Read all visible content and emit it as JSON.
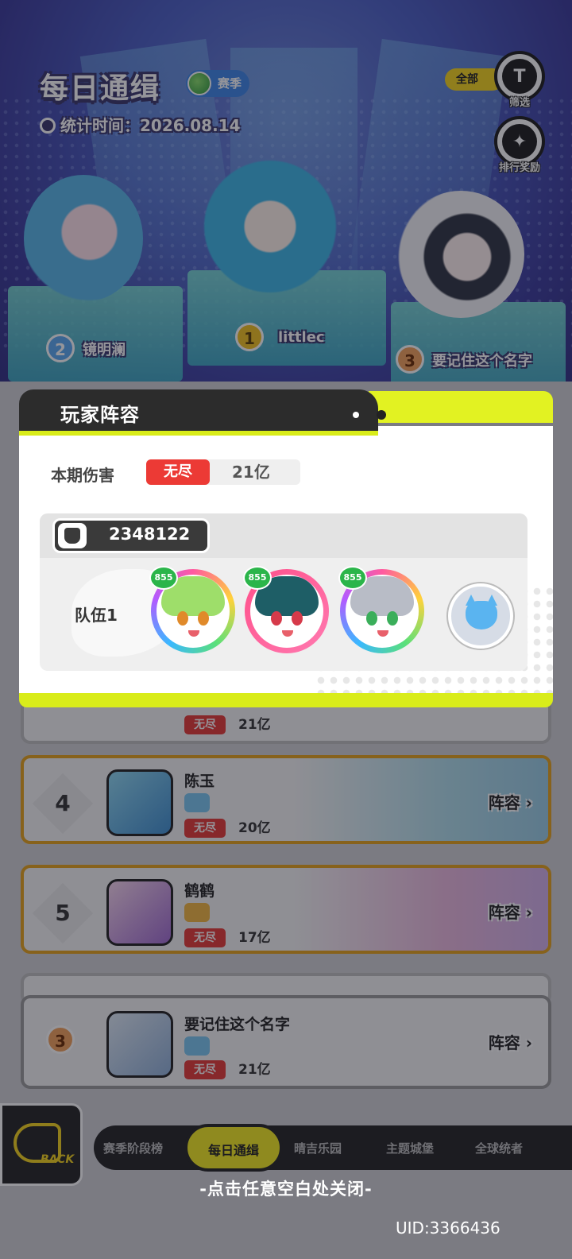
{
  "header": {
    "title": "每日通缉",
    "season": "赛季",
    "stat_time": "统计时间：2026.08.14",
    "filter_all": "全部",
    "filter_label": "筛选",
    "reward_label": "排行奖励"
  },
  "podium": [
    {
      "rank": "1",
      "name": "littlec"
    },
    {
      "rank": "2",
      "name": "镜明澜"
    },
    {
      "rank": "3",
      "name": "要记住这个名字"
    }
  ],
  "modal": {
    "title": "玩家阵容",
    "damage_label": "本期伤害",
    "damage_mode": "无尽",
    "damage_value": "21亿",
    "power": "2348122",
    "team_label": "队伍1",
    "heroes": [
      {
        "level": "855"
      },
      {
        "level": "855"
      },
      {
        "level": "855"
      }
    ]
  },
  "list": {
    "partial_row": {
      "mode": "无尽",
      "damage": "21亿"
    },
    "rows": [
      {
        "rank": "4",
        "name": "陈玉",
        "tag": "",
        "mode": "无尽",
        "damage": "20亿",
        "lineup": "阵容"
      },
      {
        "rank": "5",
        "name": "鹤鹤",
        "tag": "",
        "mode": "无尽",
        "damage": "17亿",
        "lineup": "阵容"
      }
    ],
    "self_row": {
      "rank": "3",
      "name": "要记住这个名字",
      "mode": "无尽",
      "damage": "21亿",
      "lineup": "阵容"
    }
  },
  "tabs": [
    "赛季阶段榜",
    "每日通缉",
    "晴吉乐园",
    "主题城堡",
    "全球统者"
  ],
  "active_tab": "每日通缉",
  "back_label": "BACK",
  "close_hint": "-点击任意空白处关闭-",
  "uid": "UID:3366436",
  "colors": {
    "accent_lime": "#d9ec1a",
    "mode_red": "#ec3a35",
    "rank_gold": "#e6a21a"
  }
}
